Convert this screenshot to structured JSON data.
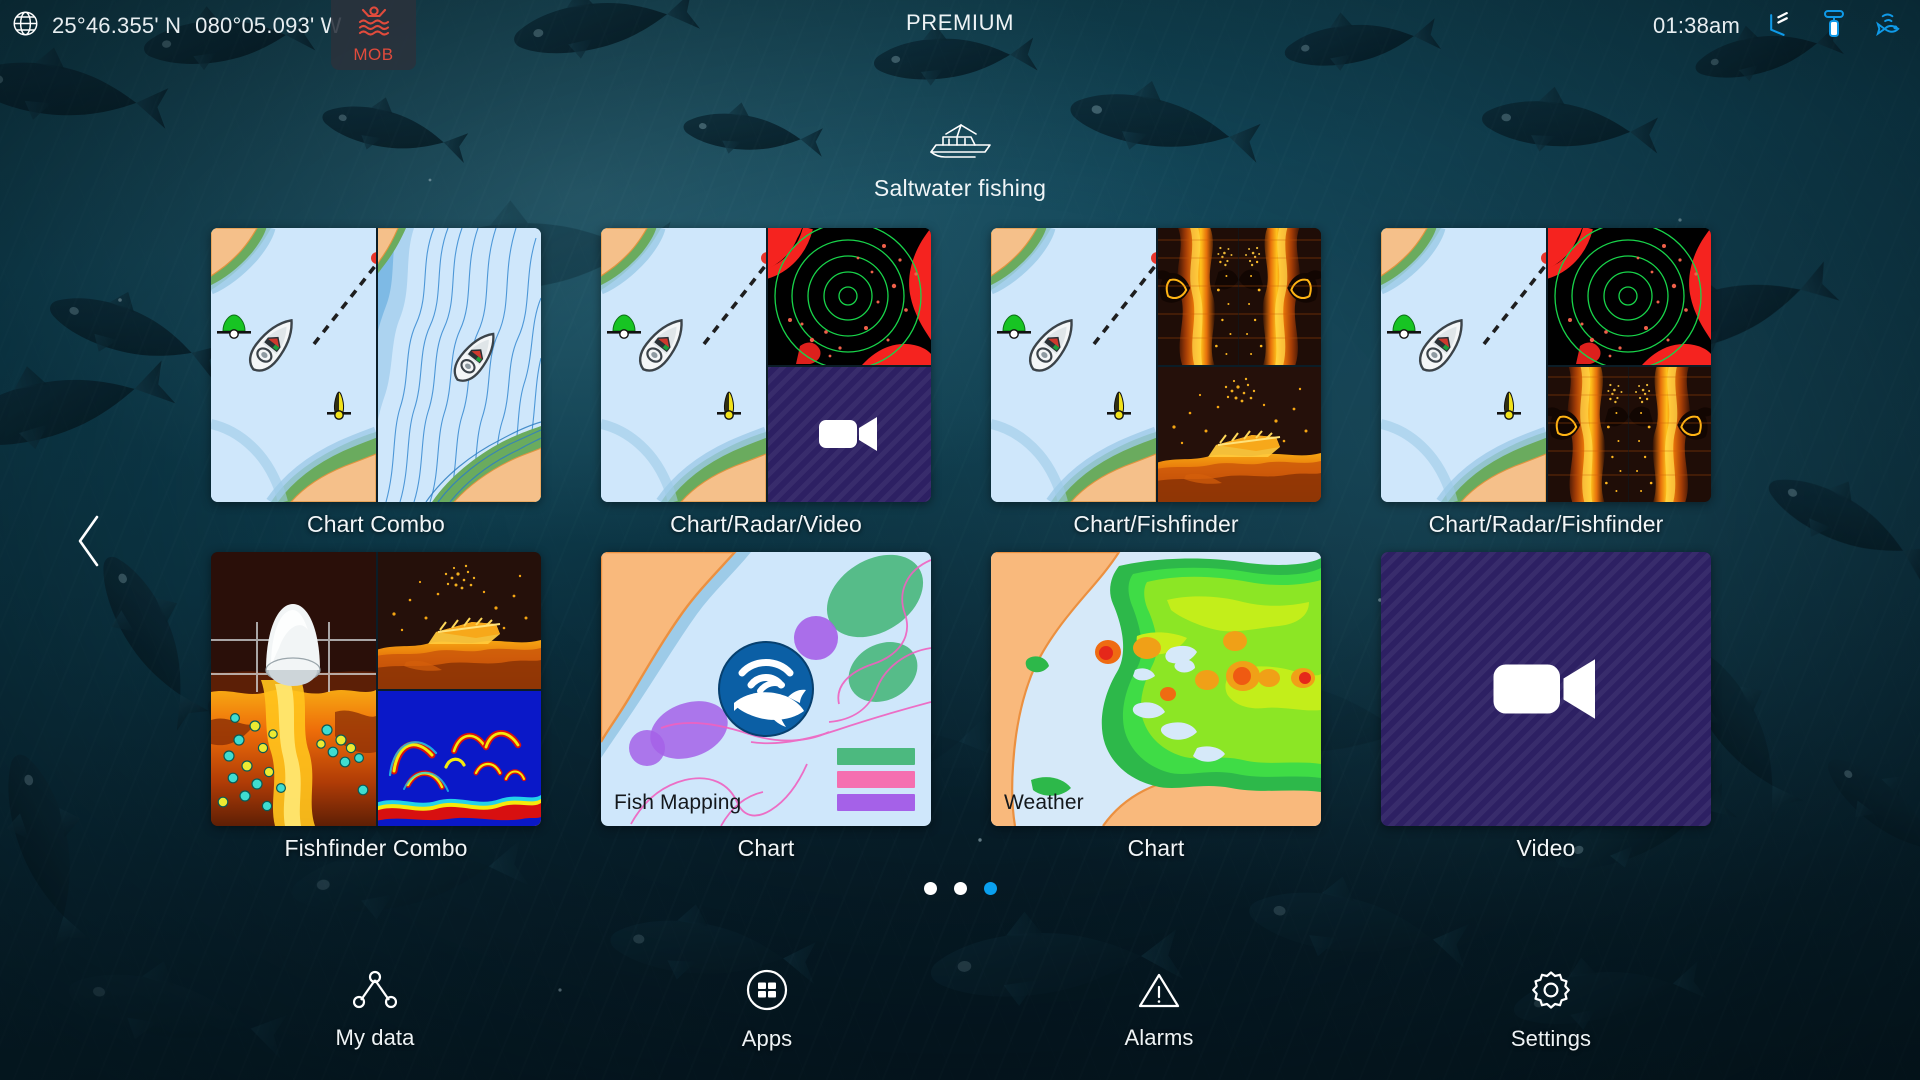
{
  "topbar": {
    "globe_icon": "globe-icon",
    "latitude": "25°46.355' N",
    "longitude": "080°05.093' W",
    "mob_label": "MOB",
    "mob_icon": "man-overboard-icon",
    "premium_label": "PREMIUM",
    "time": "01:38am",
    "wind_icon": "wind-sensor-icon",
    "fuel_icon": "fuel-tank-icon",
    "sonar_fish_icon": "sonar-fish-icon"
  },
  "page": {
    "boat_icon": "sportfish-boat-icon",
    "title": "Saltwater fishing",
    "prev_arrow_icon": "chevron-left-icon"
  },
  "tiles": [
    {
      "label": "Chart Combo",
      "layout": "chart|chart",
      "name": "chart-combo"
    },
    {
      "label": "Chart/Radar/Video",
      "layout": "chart|radar+video",
      "name": "chart-radar-video"
    },
    {
      "label": "Chart/Fishfinder",
      "layout": "chart|sonar+sonar",
      "name": "chart-fishfinder"
    },
    {
      "label": "Chart/Radar/Fishfinder",
      "layout": "chart|radar+sonar",
      "name": "chart-radar-fishfinder"
    },
    {
      "label": "Fishfinder Combo",
      "layout": "forward-sonar|sonar+arch",
      "name": "fishfinder-combo"
    },
    {
      "label": "Chart",
      "layout": "fishmapping",
      "name": "chart-fish-mapping",
      "caption": "Fish Mapping"
    },
    {
      "label": "Chart",
      "layout": "weather",
      "name": "chart-weather",
      "caption": "Weather"
    },
    {
      "label": "Video",
      "layout": "video",
      "name": "video"
    }
  ],
  "pagination": {
    "total": 3,
    "active": 3
  },
  "bottomnav": [
    {
      "label": "My data",
      "icon": "waypoints-icon",
      "name": "nav-mydata"
    },
    {
      "label": "Apps",
      "icon": "apps-grid-icon",
      "name": "nav-apps"
    },
    {
      "label": "Alarms",
      "icon": "warning-triangle-icon",
      "name": "nav-alarms"
    },
    {
      "label": "Settings",
      "icon": "gear-icon",
      "name": "nav-settings"
    }
  ],
  "colors": {
    "accent_blue": "#0aa0ef",
    "mob_red": "#e14b3c",
    "chart_land": "#f5c08a",
    "chart_shore": "#6aab5e",
    "chart_water": "#cfe7fb",
    "radar_red": "#f5231f",
    "radar_ring_green": "#18d44a",
    "video_purple": "#2d2063",
    "weather_green": "#31d63a",
    "text_primary": "#eef3f5"
  }
}
